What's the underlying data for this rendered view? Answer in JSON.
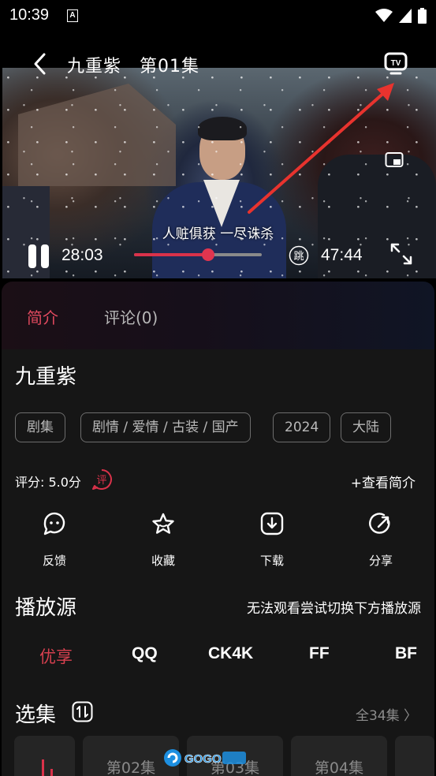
{
  "status_bar": {
    "time": "10:39",
    "notification_letter": "A"
  },
  "player": {
    "title": "九重紫　第01集",
    "subtitle": "人赃俱获 一尽诛杀",
    "current_time": "28:03",
    "total_time": "47:44",
    "progress": 0.58,
    "skip_label": "跳"
  },
  "tabs": [
    {
      "label": "简介",
      "active": true
    },
    {
      "label": "评论(0)",
      "active": false
    }
  ],
  "show": {
    "title": "九重紫",
    "tags": [
      "剧集",
      "剧情 / 爱情 / 古装 / 国产",
      "2024",
      "大陆"
    ],
    "rating": "评分: 5.0分",
    "rate_label": "评",
    "view_intro": "+查看简介"
  },
  "actions": [
    {
      "label": "反馈",
      "icon": "feedback-icon"
    },
    {
      "label": "收藏",
      "icon": "star-icon"
    },
    {
      "label": "下载",
      "icon": "download-icon"
    },
    {
      "label": "分享",
      "icon": "share-icon"
    }
  ],
  "sources": {
    "title": "播放源",
    "hint": "无法观看尝试切换下方播放源",
    "items": [
      "优享",
      "QQ",
      "CK4K",
      "FF",
      "BF"
    ],
    "active_index": 0
  },
  "episodes": {
    "title": "选集",
    "all_label": "全34集 〉",
    "items": [
      "第02集",
      "第03集",
      "第04集"
    ]
  },
  "watermark": {
    "text": "GOGO手游网"
  },
  "colors": {
    "accent": "#e0495e",
    "background": "#161616",
    "arrow": "#e8332e"
  }
}
